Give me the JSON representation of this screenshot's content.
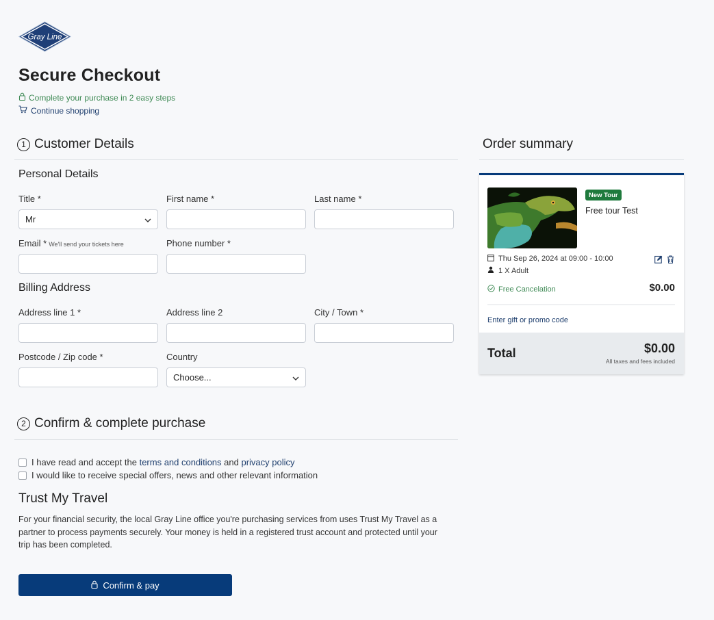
{
  "brand": {
    "logo_text": "Gray Line",
    "primary_color": "#073b7a",
    "success_color": "#3f8a55"
  },
  "header": {
    "title": "Secure Checkout",
    "secure_note": "Complete your purchase in 2 easy steps",
    "secure_icon": "lock-icon",
    "continue_label": "Continue shopping",
    "continue_icon": "cart-icon"
  },
  "customer": {
    "step": "1",
    "heading": "Customer Details",
    "personal_heading": "Personal Details",
    "title_label": "Title *",
    "title_value": "Mr",
    "first_name_label": "First name *",
    "first_name_value": "",
    "last_name_label": "Last name *",
    "last_name_value": "",
    "email_label": "Email *",
    "email_hint": "We'll send your tickets here",
    "email_value": "",
    "phone_label": "Phone number *",
    "phone_value": "",
    "billing_heading": "Billing Address",
    "address1_label": "Address line 1 *",
    "address1_value": "",
    "address2_label": "Address line 2",
    "address2_value": "",
    "city_label": "City / Town *",
    "city_value": "",
    "postcode_label": "Postcode / Zip code *",
    "postcode_value": "",
    "country_label": "Country",
    "country_value": "Choose..."
  },
  "confirm": {
    "step": "2",
    "heading": "Confirm & complete purchase",
    "terms_prefix": "I have read and accept the",
    "terms_link": "terms and conditions",
    "terms_and": "and",
    "privacy_link": "privacy policy",
    "terms_checked": false,
    "offers_label": "I would like to receive special offers, news and other relevant information",
    "offers_checked": false
  },
  "trust": {
    "title": "Trust My Travel",
    "text": "For your financial security, the local Gray Line office you're purchasing services from uses Trust My Travel as a partner to process payments securely. Your money is held in a registered trust account and protected until your trip has been completed."
  },
  "pay_button": {
    "label": "Confirm & pay",
    "icon": "lock-icon"
  },
  "summary": {
    "heading": "Order summary",
    "badge": "New Tour",
    "tour_name": "Free tour Test",
    "date": "Thu Sep 26, 2024 at 09:00 - 10:00",
    "travellers": "1 X Adult",
    "cancellation": "Free Cancelation",
    "price": "$0.00",
    "promo_link": "Enter gift or promo code",
    "total_label": "Total",
    "total_value": "$0.00",
    "tax_note": "All taxes and fees included"
  }
}
